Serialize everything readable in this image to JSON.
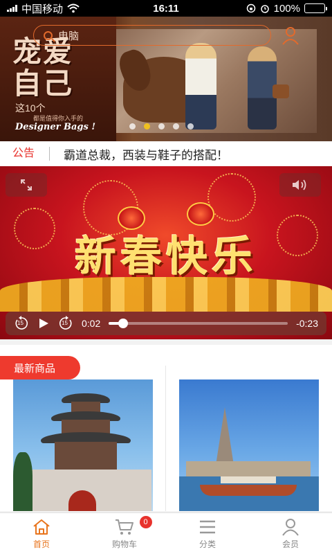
{
  "status_bar": {
    "carrier": "中国移动",
    "time": "16:11",
    "battery": "100%"
  },
  "banner": {
    "big_text_line1": "宠爱",
    "big_text_line2": "自己",
    "sub_line1": "这10个",
    "sub_line2": "都是值得你入手的",
    "sub_line3": "Designer Bags !",
    "slide_count": 5,
    "active_slide": 1,
    "colors": {
      "active_dot": "#f0c020"
    }
  },
  "search": {
    "value": "电脑"
  },
  "notice": {
    "tag": "公告",
    "text": "霸道总裁，西装与鞋子的搭配！"
  },
  "video": {
    "title": "新春快乐",
    "current_time": "0:02",
    "remaining_time": "-0:23",
    "progress": 0.08,
    "rewind_label": "15",
    "forward_label": "15"
  },
  "new_products": {
    "section_title": "最新商品"
  },
  "tab_bar": {
    "items": [
      {
        "label": "首页",
        "icon": "home-icon",
        "active": true
      },
      {
        "label": "购物车",
        "icon": "cart-icon",
        "badge": "0"
      },
      {
        "label": "分类",
        "icon": "menu-icon"
      },
      {
        "label": "会员",
        "icon": "user-icon"
      }
    ],
    "colors": {
      "active": "#e8741c",
      "badge": "#e8322c"
    }
  }
}
